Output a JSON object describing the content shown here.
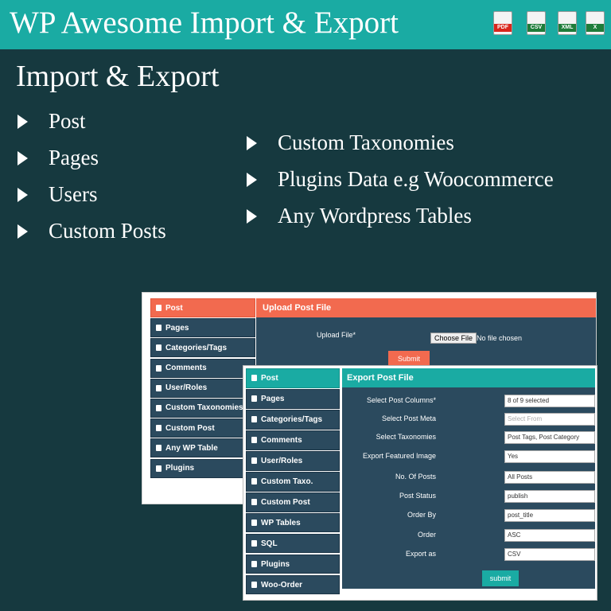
{
  "banner": {
    "title": "WP Awesome Import & Export",
    "file_icons": [
      {
        "name": "pdf-file-icon",
        "tag": "PDF",
        "color": "#d9261c"
      },
      {
        "name": "csv-file-icon",
        "tag": "CSV",
        "color": "#1e7d3a"
      },
      {
        "name": "xml-file-icon",
        "tag": "XML",
        "color": "#1e7d3a"
      },
      {
        "name": "excel-file-icon",
        "tag": "X",
        "color": "#1e7d3a"
      }
    ]
  },
  "heading": "Import & Export",
  "features_left": [
    "Post",
    "Pages",
    "Users",
    "Custom Posts"
  ],
  "features_right": [
    "Custom Taxonomies",
    "Plugins Data e.g Woocommerce",
    "Any Wordpress Tables"
  ],
  "back_panel": {
    "menu": [
      "Post",
      "Pages",
      "Categories/Tags",
      "Comments",
      "User/Roles",
      "Custom Taxonomies",
      "Custom Post",
      "Any WP Table",
      "Plugins"
    ],
    "header": "Upload Post File",
    "upload_label": "Upload File*",
    "choose_button": "Choose File",
    "no_file": "No file chosen",
    "submit": "Submit"
  },
  "front_panel": {
    "menu": [
      "Post",
      "Pages",
      "Categories/Tags",
      "Comments",
      "User/Roles",
      "Custom Taxo.",
      "Custom Post",
      "WP Tables",
      "SQL",
      "Plugins",
      "Woo-Order"
    ],
    "header": "Export Post File",
    "fields": [
      {
        "label": "Select Post Columns*",
        "value": "8 of 9 selected"
      },
      {
        "label": "Select Post Meta",
        "value": "Select From"
      },
      {
        "label": "Select Taxonomies",
        "value": "Post Tags, Post Category"
      },
      {
        "label": "Export Featured Image",
        "value": "Yes"
      },
      {
        "label": "No. Of Posts",
        "value": "All Posts"
      },
      {
        "label": "Post Status",
        "value": "publish"
      },
      {
        "label": "Order By",
        "value": "post_title"
      },
      {
        "label": "Order",
        "value": "ASC"
      },
      {
        "label": "Export as",
        "value": "CSV"
      }
    ],
    "submit": "submit"
  },
  "colors": {
    "banner": "#1aaba3",
    "background": "#16393f",
    "orange": "#f26a4f",
    "teal": "#1aaba3",
    "navy": "#2b4a5e"
  }
}
